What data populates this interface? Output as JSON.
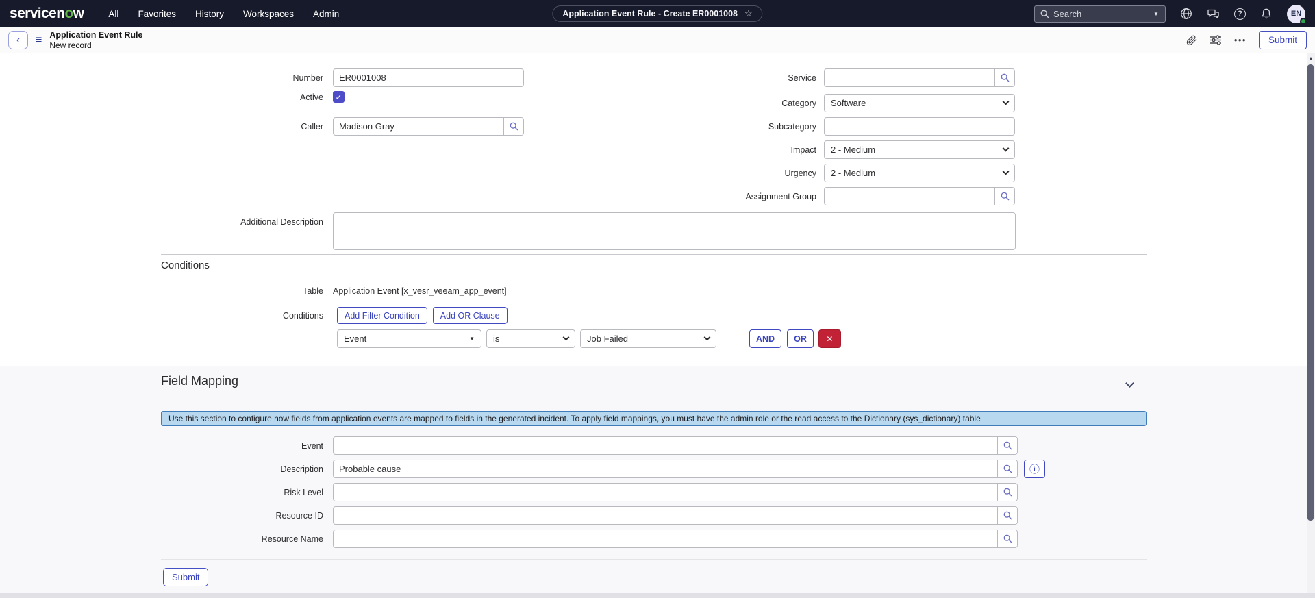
{
  "colors": {
    "nav_bg": "#171a2b",
    "accent_blue": "#3a44bd",
    "checkbox_purple": "#4f4cc9",
    "delete_red": "#c22236",
    "banner_bg": "#b8d8ef",
    "banner_border": "#3f7cb8",
    "logo_green": "#62b549",
    "status_green": "#2ea44f"
  },
  "icons": {
    "star": "☆",
    "caret_down": "▼",
    "hamburger": "≡",
    "back_chevron": "‹",
    "more_dots": "•••",
    "check": "✓",
    "close": "✕",
    "info": "ⓘ",
    "scroll_up": "▲",
    "help": "?"
  },
  "topnav": {
    "logo_pre": "servicen",
    "logo_green": "o",
    "logo_post": "w",
    "items": [
      "All",
      "Favorites",
      "History",
      "Workspaces",
      "Admin"
    ],
    "pill_title": "Application Event Rule - Create ER0001008",
    "search_placeholder": "Search",
    "avatar_initials": "EN"
  },
  "subheader": {
    "title": "Application Event Rule",
    "subtitle": "New record",
    "submit_label": "Submit"
  },
  "form": {
    "number": {
      "label": "Number",
      "value": "ER0001008"
    },
    "active": {
      "label": "Active"
    },
    "caller": {
      "label": "Caller",
      "value": "Madison Gray"
    },
    "service": {
      "label": "Service",
      "value": ""
    },
    "category": {
      "label": "Category",
      "value": "Software"
    },
    "subcategory": {
      "label": "Subcategory",
      "value": ""
    },
    "impact": {
      "label": "Impact",
      "value": "2 - Medium"
    },
    "urgency": {
      "label": "Urgency",
      "value": "2 - Medium"
    },
    "assignment_group": {
      "label": "Assignment Group",
      "value": ""
    },
    "additional_description": {
      "label": "Additional Description",
      "value": ""
    }
  },
  "conditions": {
    "heading": "Conditions",
    "table_label": "Table",
    "table_value": "Application Event [x_vesr_veeam_app_event]",
    "conditions_label": "Conditions",
    "add_filter_label": "Add Filter Condition",
    "add_or_label": "Add OR Clause",
    "row": {
      "field": "Event",
      "operator": "is",
      "value": "Job Failed"
    },
    "and_label": "AND",
    "or_label": "OR"
  },
  "field_mapping": {
    "heading": "Field Mapping",
    "info_text": "Use this section to configure how fields from application events are mapped to fields in the generated incident. To apply field mappings, you must have the admin role or the read access to the Dictionary (sys_dictionary) table",
    "event": {
      "label": "Event",
      "value": ""
    },
    "description": {
      "label": "Description",
      "value": "Probable cause"
    },
    "risk_level": {
      "label": "Risk Level",
      "value": ""
    },
    "resource_id": {
      "label": "Resource ID",
      "value": ""
    },
    "resource_name": {
      "label": "Resource Name",
      "value": ""
    },
    "submit_label": "Submit"
  }
}
